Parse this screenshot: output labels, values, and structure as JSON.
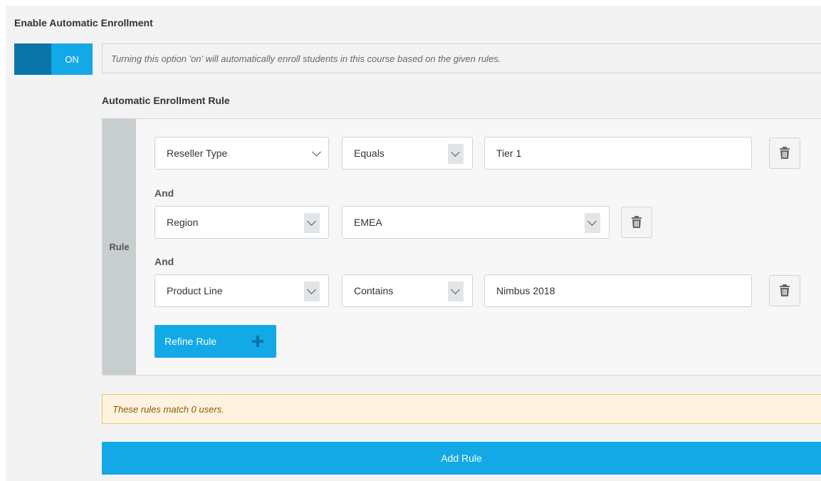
{
  "enrollment": {
    "title": "Enable Automatic Enrollment",
    "toggle_label": "ON",
    "help_text": "Turning this option 'on' will automatically enroll students in this course based on the given rules."
  },
  "rule_section": {
    "title": "Automatic Enrollment Rule",
    "side_label": "Rule",
    "conditions": [
      {
        "field": "Reseller Type",
        "operator": "Equals",
        "value": "Tier 1"
      },
      {
        "field": "Region",
        "value": "EMEA"
      },
      {
        "field": "Product Line",
        "operator": "Contains",
        "value": "Nimbus 2018"
      }
    ],
    "conjunction": "And",
    "refine_label": "Refine Rule"
  },
  "match_text": "These rules match 0 users.",
  "add_rule_label": "Add Rule",
  "colors": {
    "accent": "#12a9e6",
    "accent_dark": "#0a75a8",
    "alert_bg": "#fdf3e0",
    "alert_border": "#f1c56a"
  },
  "icons": {
    "trash": "trash-icon",
    "chevron": "chevron-down-icon",
    "plus": "plus-icon"
  }
}
